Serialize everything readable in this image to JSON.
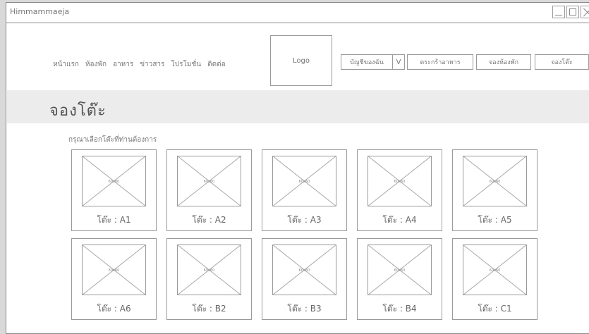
{
  "window": {
    "title": "Himmammaeja"
  },
  "nav": {
    "items": [
      "หน้าแรก",
      "ห้องพัก",
      "อาหาร",
      "ข่าวสาร",
      "โปรโมชั่น",
      "ติดต่อ"
    ]
  },
  "logo": {
    "label": "Logo"
  },
  "account": {
    "label": "บัญชีของฉัน",
    "caret": "V"
  },
  "top_buttons": [
    "ตระกร้าอาหาร",
    "จองห้องพัก",
    "จองโต๊ะ"
  ],
  "page": {
    "title": "จองโต๊ะ",
    "instruction": "กรุณาเลือกโต๊ะที่ท่านต้องการ"
  },
  "tables": [
    {
      "size": "60x60",
      "label": "โต๊ะ : A1"
    },
    {
      "size": "60x60",
      "label": "โต๊ะ : A2"
    },
    {
      "size": "60x60",
      "label": "โต๊ะ : A3"
    },
    {
      "size": "60x60",
      "label": "โต๊ะ : A4"
    },
    {
      "size": "60x60",
      "label": "โต๊ะ : A5"
    },
    {
      "size": "60x60",
      "label": "โต๊ะ : A6"
    },
    {
      "size": "60x60",
      "label": "โต๊ะ : B2"
    },
    {
      "size": "60x60",
      "label": "โต๊ะ : B3"
    },
    {
      "size": "60x60",
      "label": "โต๊ะ : B4"
    },
    {
      "size": "60x60",
      "label": "โต๊ะ : C1"
    }
  ]
}
